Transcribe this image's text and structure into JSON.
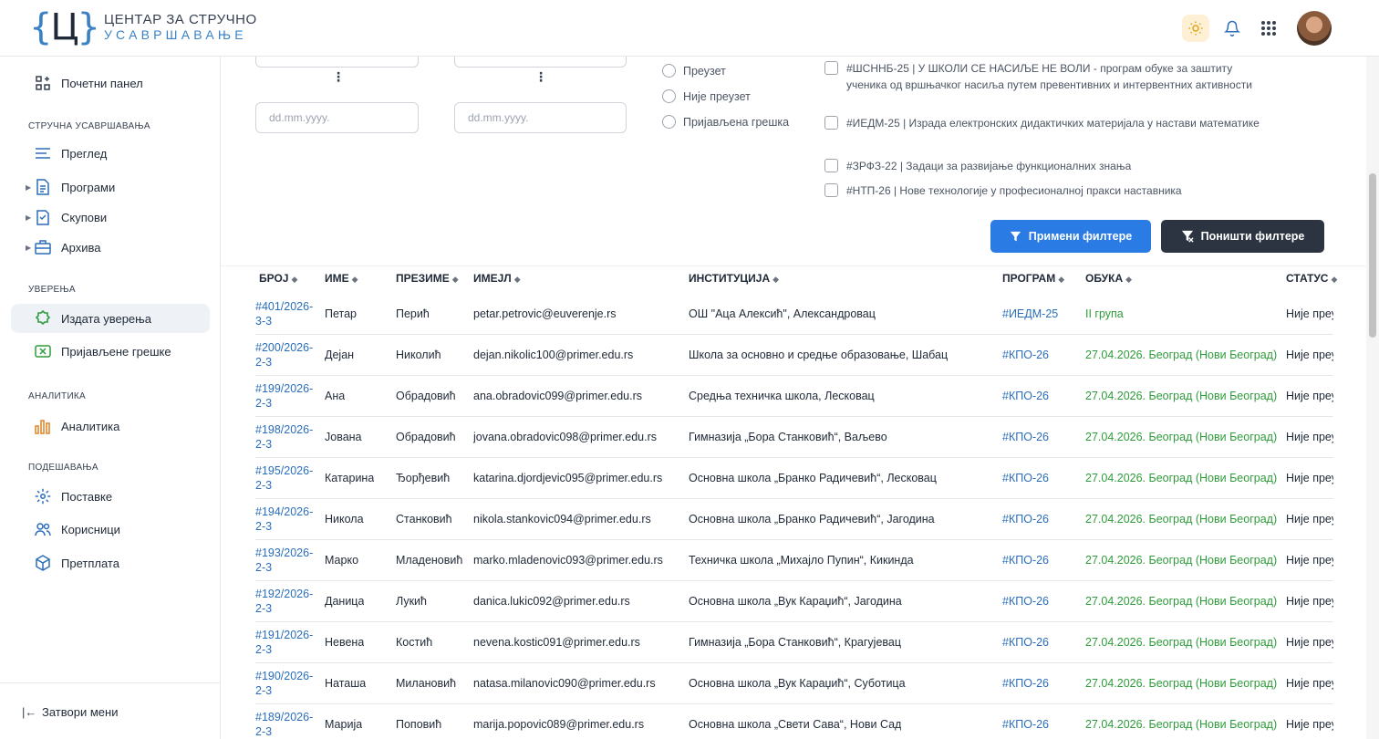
{
  "header": {
    "logo_letter": "Ц",
    "logo_line1": "ЦЕНТАР ЗА СТРУЧНО",
    "logo_line2": "УСАВРШАВАЊЕ"
  },
  "sidebar": {
    "dashboard": "Почетни панел",
    "section_training": "СТРУЧНА УСАВРШАВАЊА",
    "overview": "Преглед",
    "programs": "Програми",
    "gatherings": "Скупови",
    "archive": "Архива",
    "section_certs": "УВЕРЕЊА",
    "issued": "Издата уверења",
    "reported_errors": "Пријављене грешке",
    "section_analytics": "АНАЛИТИКА",
    "analytics": "Аналитика",
    "section_settings": "ПОДЕШАВАЊА",
    "settings": "Поставке",
    "users": "Корисници",
    "subscription": "Претплата",
    "collapse": "Затвори мени"
  },
  "filters": {
    "date_placeholder": "dd.mm.yyyy.",
    "radio_taken": "Преузет",
    "radio_not_taken": "Није преузет",
    "radio_error": "Пријављена грешка",
    "programs": [
      "#ШСННБ-25 | У ШКОЛИ СЕ НАСИЉЕ НЕ ВОЛИ - програм обуке за заштиту ученика од вршњачког насиља путем превентивних и интервентних активности",
      "#ИЕДМ-25 | Израда електронских дидактичких материјала у настави математике",
      "#ЗРФЗ-22 | Задаци за развијање функционалних знања",
      "#НТП-26 | Нове технологије у професионалној пракси наставника"
    ],
    "apply": "Примени филтере",
    "reset": "Поништи филтере"
  },
  "table": {
    "headers": {
      "num": "БРОЈ",
      "first": "ИМЕ",
      "last": "ПРЕЗИМЕ",
      "email": "ИМЕЈЛ",
      "inst": "ИНСТИТУЦИЈА",
      "program": "ПРОГРАМ",
      "training": "ОБУКА",
      "status": "СТАТУС"
    },
    "rows": [
      {
        "num": "#401/2026-3-3",
        "first": "Петар",
        "last": "Перић",
        "email": "petar.petrovic@euverenje.rs",
        "inst": "ОШ \"Аца Алексић\", Александровац",
        "program": "#ИЕДМ-25",
        "training": "II група",
        "status": "Није преузет"
      },
      {
        "num": "#200/2026-2-3",
        "first": "Дејан",
        "last": "Николић",
        "email": "dejan.nikolic100@primer.edu.rs",
        "inst": "Школа за основно и средње образовање, Шабац",
        "program": "#КПО-26",
        "training": "27.04.2026. Београд (Нови Београд)",
        "status": "Није преузет"
      },
      {
        "num": "#199/2026-2-3",
        "first": "Ана",
        "last": "Обрадовић",
        "email": "ana.obradovic099@primer.edu.rs",
        "inst": "Средња техничка школа, Лесковац",
        "program": "#КПО-26",
        "training": "27.04.2026. Београд (Нови Београд)",
        "status": "Није преузет"
      },
      {
        "num": "#198/2026-2-3",
        "first": "Јована",
        "last": "Обрадовић",
        "email": "jovana.obradovic098@primer.edu.rs",
        "inst": "Гимназија „Бора Станковић“, Ваљево",
        "program": "#КПО-26",
        "training": "27.04.2026. Београд (Нови Београд)",
        "status": "Није преузет"
      },
      {
        "num": "#195/2026-2-3",
        "first": "Катарина",
        "last": "Ђорђевић",
        "email": "katarina.djordjevic095@primer.edu.rs",
        "inst": "Основна школа „Бранко Радичевић“, Лесковац",
        "program": "#КПО-26",
        "training": "27.04.2026. Београд (Нови Београд)",
        "status": "Није преузет"
      },
      {
        "num": "#194/2026-2-3",
        "first": "Никола",
        "last": "Станковић",
        "email": "nikola.stankovic094@primer.edu.rs",
        "inst": "Основна школа „Бранко Радичевић“, Јагодина",
        "program": "#КПО-26",
        "training": "27.04.2026. Београд (Нови Београд)",
        "status": "Није преузет"
      },
      {
        "num": "#193/2026-2-3",
        "first": "Марко",
        "last": "Младеновић",
        "email": "marko.mladenovic093@primer.edu.rs",
        "inst": "Техничка школа „Михајло Пупин“, Кикинда",
        "program": "#КПО-26",
        "training": "27.04.2026. Београд (Нови Београд)",
        "status": "Није преузет"
      },
      {
        "num": "#192/2026-2-3",
        "first": "Даница",
        "last": "Лукић",
        "email": "danica.lukic092@primer.edu.rs",
        "inst": "Основна школа „Вук Караџић“, Јагодина",
        "program": "#КПО-26",
        "training": "27.04.2026. Београд (Нови Београд)",
        "status": "Није преузет"
      },
      {
        "num": "#191/2026-2-3",
        "first": "Невена",
        "last": "Костић",
        "email": "nevena.kostic091@primer.edu.rs",
        "inst": "Гимназија „Бора Станковић“, Крагујевац",
        "program": "#КПО-26",
        "training": "27.04.2026. Београд (Нови Београд)",
        "status": "Није преузет"
      },
      {
        "num": "#190/2026-2-3",
        "first": "Наташа",
        "last": "Милановић",
        "email": "natasa.milanovic090@primer.edu.rs",
        "inst": "Основна школа „Вук Караџић“, Суботица",
        "program": "#КПО-26",
        "training": "27.04.2026. Београд (Нови Београд)",
        "status": "Није преузет"
      },
      {
        "num": "#189/2026-2-3",
        "first": "Марија",
        "last": "Поповић",
        "email": "marija.popovic089@primer.edu.rs",
        "inst": "Основна школа „Свети Сава“, Нови Сад",
        "program": "#КПО-26",
        "training": "27.04.2026. Београд (Нови Београд)",
        "status": "Није преузет"
      }
    ]
  },
  "colors": {
    "accent": "#2a7be4",
    "link": "#2a6ebb",
    "success": "#2e9c3a",
    "dark_button": "#2b3440"
  }
}
